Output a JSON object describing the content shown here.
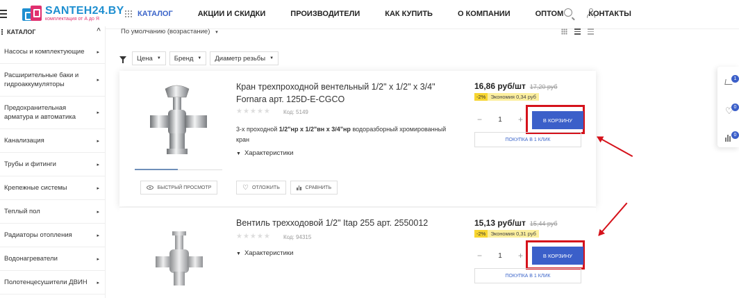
{
  "header": {
    "logo_title": "SANTEH24.BY",
    "logo_subtitle": "комплектация от А до Я",
    "nav": [
      "КАТАЛОГ",
      "АКЦИИ И СКИДКИ",
      "ПРОИЗВОДИТЕЛИ",
      "КАК КУПИТЬ",
      "О КОМПАНИИ",
      "ОПТОМ",
      "КОНТАКТЫ"
    ],
    "icons": [
      "search-icon",
      "user-icon"
    ]
  },
  "sidebar": {
    "title": "КАТАЛОГ",
    "items": [
      {
        "label": "Насосы и комплектующие"
      },
      {
        "label": "Расширительные баки и гидроаккумуляторы"
      },
      {
        "label": "Предохранительная арматура и автоматика"
      },
      {
        "label": "Канализация"
      },
      {
        "label": "Трубы и фитинги"
      },
      {
        "label": "Крепежные системы"
      },
      {
        "label": "Теплый пол"
      },
      {
        "label": "Радиаторы отопления"
      },
      {
        "label": "Водонагреватели"
      },
      {
        "label": "Полотенцесушители ДВИН"
      }
    ]
  },
  "toolbar": {
    "sort_label": "По умолчанию (возрастание)",
    "filters": [
      "Цена",
      "Бренд",
      "Диаметр резьбы"
    ]
  },
  "products": [
    {
      "name": "Кран трехпроходной вентельный 1/2\" х 1/2\" х 3/4\" Fornara арт. 125D-E-CGCO",
      "code": "Код: 5149",
      "desc_prefix": "3-х проходной ",
      "desc_bold": "1/2\"нр x 1/2\"вн x 3/4\"нр",
      "desc_suffix": " водоразборный хромированный кран",
      "chars": "Характеристики",
      "quick_view": "быстрый просмотр",
      "defer": "отложить",
      "compare": "сравнить",
      "price": "16,86 руб/шт",
      "old_price": "17,20 руб",
      "discount": "-2%",
      "economy": "Экономия 0,34 руб",
      "qty": "1",
      "cart": "В корзину",
      "one_click": "Покупка в 1 клик"
    },
    {
      "name": "Вентиль трехходовой 1/2\" Itap 255 арт. 2550012",
      "code": "Код: 94315",
      "chars": "Характеристики",
      "price": "15,13 руб/шт",
      "old_price": "15,44 руб",
      "discount": "-2%",
      "economy": "Экономия 0,31 руб",
      "qty": "1",
      "cart": "В корзину",
      "one_click": "Покупка в 1 клик"
    }
  ],
  "widget": {
    "badges": [
      "1",
      "0",
      "0"
    ]
  },
  "colors": {
    "accent": "#3b5fc9",
    "highlight": "#d5121b",
    "brand_blue": "#1f8fd0",
    "brand_pink": "#e0306f"
  }
}
